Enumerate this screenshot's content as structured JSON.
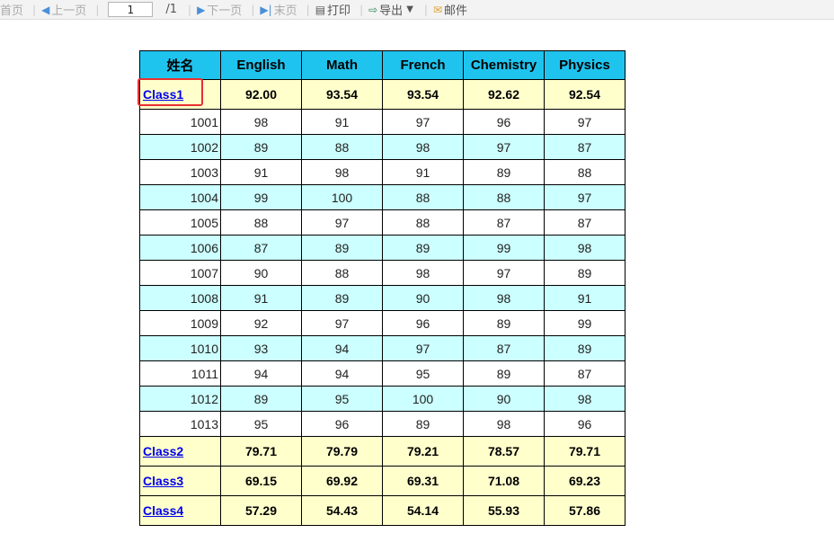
{
  "toolbar": {
    "first_page": "首页",
    "prev_page": "上一页",
    "page_value": "1",
    "page_total": "/1",
    "next_page": "下一页",
    "last_page": "末页",
    "print": "打印",
    "export": "导出",
    "mail": "邮件"
  },
  "table": {
    "headers": [
      "姓名",
      "English",
      "Math",
      "French",
      "Chemistry",
      "Physics"
    ],
    "class1": {
      "name": "Class1",
      "scores": [
        "92.00",
        "93.54",
        "93.54",
        "92.62",
        "92.54"
      ]
    },
    "students": [
      {
        "id": "1001",
        "scores": [
          "98",
          "91",
          "97",
          "96",
          "97"
        ]
      },
      {
        "id": "1002",
        "scores": [
          "89",
          "88",
          "98",
          "97",
          "87"
        ]
      },
      {
        "id": "1003",
        "scores": [
          "91",
          "98",
          "91",
          "89",
          "88"
        ]
      },
      {
        "id": "1004",
        "scores": [
          "99",
          "100",
          "88",
          "88",
          "97"
        ]
      },
      {
        "id": "1005",
        "scores": [
          "88",
          "97",
          "88",
          "87",
          "87"
        ]
      },
      {
        "id": "1006",
        "scores": [
          "87",
          "89",
          "89",
          "99",
          "98"
        ]
      },
      {
        "id": "1007",
        "scores": [
          "90",
          "88",
          "98",
          "97",
          "89"
        ]
      },
      {
        "id": "1008",
        "scores": [
          "91",
          "89",
          "90",
          "98",
          "91"
        ]
      },
      {
        "id": "1009",
        "scores": [
          "92",
          "97",
          "96",
          "89",
          "99"
        ]
      },
      {
        "id": "1010",
        "scores": [
          "93",
          "94",
          "97",
          "87",
          "89"
        ]
      },
      {
        "id": "1011",
        "scores": [
          "94",
          "94",
          "95",
          "89",
          "87"
        ]
      },
      {
        "id": "1012",
        "scores": [
          "89",
          "95",
          "100",
          "90",
          "98"
        ]
      },
      {
        "id": "1013",
        "scores": [
          "95",
          "96",
          "89",
          "98",
          "96"
        ]
      }
    ],
    "classes": [
      {
        "name": "Class2",
        "scores": [
          "79.71",
          "79.79",
          "79.21",
          "78.57",
          "79.71"
        ]
      },
      {
        "name": "Class3",
        "scores": [
          "69.15",
          "69.92",
          "69.31",
          "71.08",
          "69.23"
        ]
      },
      {
        "name": "Class4",
        "scores": [
          "57.29",
          "54.43",
          "54.14",
          "55.93",
          "57.86"
        ]
      }
    ]
  },
  "colors": {
    "header_bg": "#1fc4ee",
    "summary_bg": "#ffffcc",
    "alt_row_bg": "#ccffff",
    "highlight": "#e83030"
  }
}
